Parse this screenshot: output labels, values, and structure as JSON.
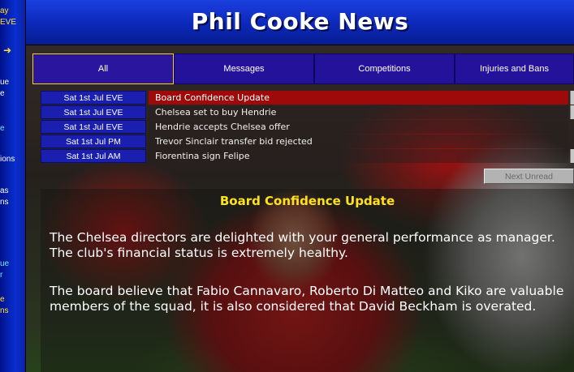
{
  "header": {
    "title": "Phil Cooke News"
  },
  "sidebar": {
    "items": [
      {
        "label": "ay"
      },
      {
        "label": "EVE"
      },
      {
        "label": "ue"
      },
      {
        "label": "e"
      },
      {
        "label": "e"
      },
      {
        "label": "ions"
      },
      {
        "label": "as"
      },
      {
        "label": "ns"
      },
      {
        "label": "ue"
      },
      {
        "label": "r"
      },
      {
        "label": "e"
      },
      {
        "label": "ns"
      }
    ]
  },
  "tabs": [
    {
      "label": "All",
      "active": true
    },
    {
      "label": "Messages"
    },
    {
      "label": "Competitions"
    },
    {
      "label": "Injuries and Bans"
    }
  ],
  "news": [
    {
      "date": "Sat 1st Jul EVE",
      "headline": "Board Confidence Update",
      "selected": true
    },
    {
      "date": "Sat 1st Jul EVE",
      "headline": "Chelsea set to buy Hendrie"
    },
    {
      "date": "Sat 1st Jul EVE",
      "headline": "Hendrie accepts Chelsea offer"
    },
    {
      "date": "Sat 1st Jul PM",
      "headline": "Trevor Sinclair transfer bid rejected"
    },
    {
      "date": "Sat 1st Jul AM",
      "headline": "Fiorentina sign Felipe"
    }
  ],
  "next_unread_label": "Next Unread",
  "article": {
    "title": "Board Confidence Update",
    "paragraphs": [
      "The Chelsea directors are delighted with your general performance as manager. The club's financial status is extremely healthy.",
      "The board believe that Fabio Cannavaro, Roberto Di Matteo and Kiko are valuable members of the squad, it is also considered that David Beckham is overated."
    ]
  },
  "colors": {
    "header_blue": "#0c28b8",
    "tab_purple": "#25129a",
    "active_tab_border": "#ffd21a",
    "selected_row_red": "#9e0a0a",
    "article_title_yellow": "#ffe21a"
  }
}
